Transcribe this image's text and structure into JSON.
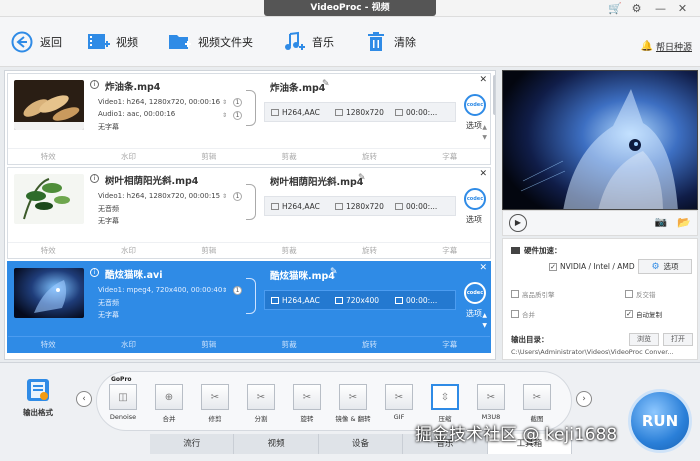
{
  "window": {
    "title": "VideoProc - 视频"
  },
  "toolbar": {
    "back": "返回",
    "video": "视频",
    "video_folder": "视频文件夹",
    "music": "音乐",
    "clear": "清除",
    "help": "帮日种源"
  },
  "items": [
    {
      "name": "炸油条.mp4",
      "video": "Video1: h264, 1280x720, 00:00:16",
      "audio": "Audio1: aac, 00:00:16",
      "subtitle": "无字幕",
      "count1": "1",
      "count2": "1",
      "out_name": "炸油条.mp4",
      "out_format": "H264,AAC",
      "out_res": "1280x720",
      "out_dur": "00:00:..."
    },
    {
      "name": "树叶相荫阳光斜.mp4",
      "video": "Video1: h264, 1280x720, 00:00:15",
      "audio": "无音频",
      "subtitle": "无字幕",
      "count1": "1",
      "out_name": "树叶相荫阳光斜.mp4",
      "out_format": "H264,AAC",
      "out_res": "1280x720",
      "out_dur": "00:00:..."
    },
    {
      "name": "酷炫猫咪.avi",
      "video": "Video1: mpeg4, 720x400, 00:00:40",
      "audio": "无音频",
      "subtitle": "无字幕",
      "count1": "1",
      "out_name": "酷炫猫咪.mp4",
      "out_format": "H264,AAC",
      "out_res": "720x400",
      "out_dur": "00:00:..."
    }
  ],
  "item_common": {
    "codec": "codec",
    "options": "选项",
    "edit_effects": "特效",
    "edit_watermark": "水印",
    "edit_cut": "剪辑",
    "edit_crop": "剪裁",
    "edit_rotate": "旋转",
    "edit_subtitle": "字幕"
  },
  "settings": {
    "hw_accel": "硬件加速：",
    "nvidia": "NVIDIA / Intel / AMD",
    "options_btn": "选项",
    "high_quality": "高品质引擎",
    "deinterlace": "反交错",
    "merge": "合并",
    "auto_copy": "自动复制",
    "output_dir": "输出目录：",
    "browse": "浏览",
    "open": "打开",
    "path": "C:\\Users\\Administrator\\Videos\\VideoProc Conver..."
  },
  "bottom": {
    "output_format": "输出格式",
    "formats": [
      {
        "label": "Denoise"
      },
      {
        "label": "合并"
      },
      {
        "label": "修剪"
      },
      {
        "label": "分割"
      },
      {
        "label": "旋转"
      },
      {
        "label": "镜像 & 翻转"
      },
      {
        "label": "GIF"
      },
      {
        "label": "压缩"
      },
      {
        "label": "M3U8"
      },
      {
        "label": "截图"
      }
    ],
    "gopro": "GoPro",
    "tabs": [
      "流行",
      "视频",
      "设备",
      "音乐",
      "工具箱"
    ],
    "run": "RUN"
  },
  "watermark": "掘金技术社区 @ keji1688",
  "colors": {
    "accent": "#2f8be6",
    "selected_row": "#2f8be6",
    "alert": "#e0492b"
  }
}
